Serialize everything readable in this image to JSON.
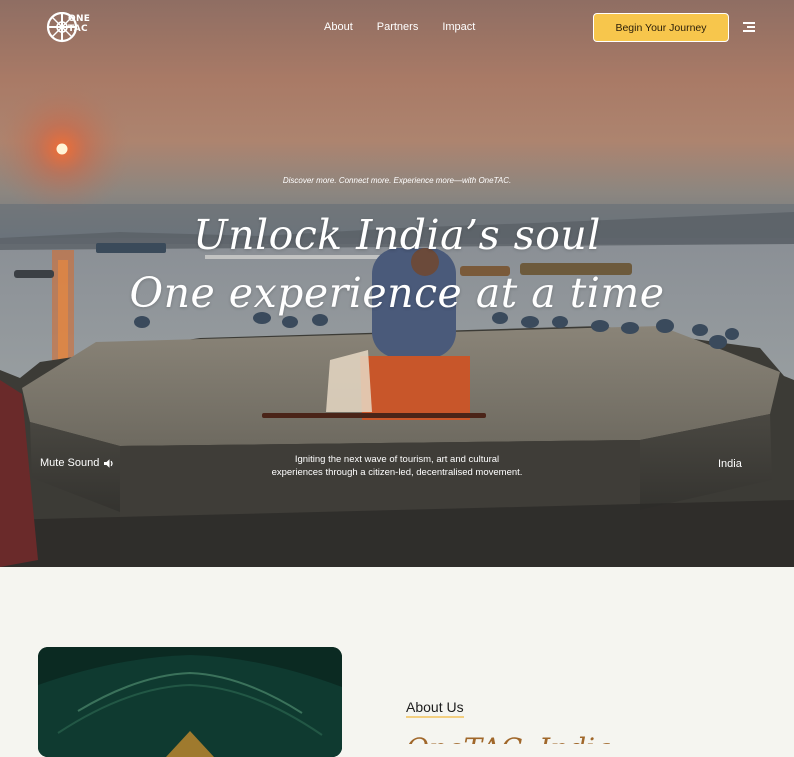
{
  "brand": {
    "name": "OneTAC",
    "logo_line1": "ONE",
    "logo_line2": "TAC"
  },
  "nav": {
    "links": [
      "About",
      "Partners",
      "Impact"
    ],
    "cta": "Begin Your Journey",
    "menu_icon": "hamburger-icon"
  },
  "hero": {
    "tagline": "Discover more. Connect more. Experience more—with OneTAC.",
    "headline_line1": "Unlock India’s soul",
    "headline_line2": "One experience at a time",
    "subtext_line1": "Igniting the next wave of tourism, art and cultural",
    "subtext_line2": "experiences through a citizen-led, decentralised movement.",
    "mute_label": "Mute Sound",
    "location": "India"
  },
  "about": {
    "label": "About Us",
    "title": "OneTAC, India..."
  },
  "colors": {
    "accent": "#f7c64c",
    "page_bg": "#f5f5f0",
    "about_title": "#a0672a",
    "underline": "#f3cf80"
  }
}
